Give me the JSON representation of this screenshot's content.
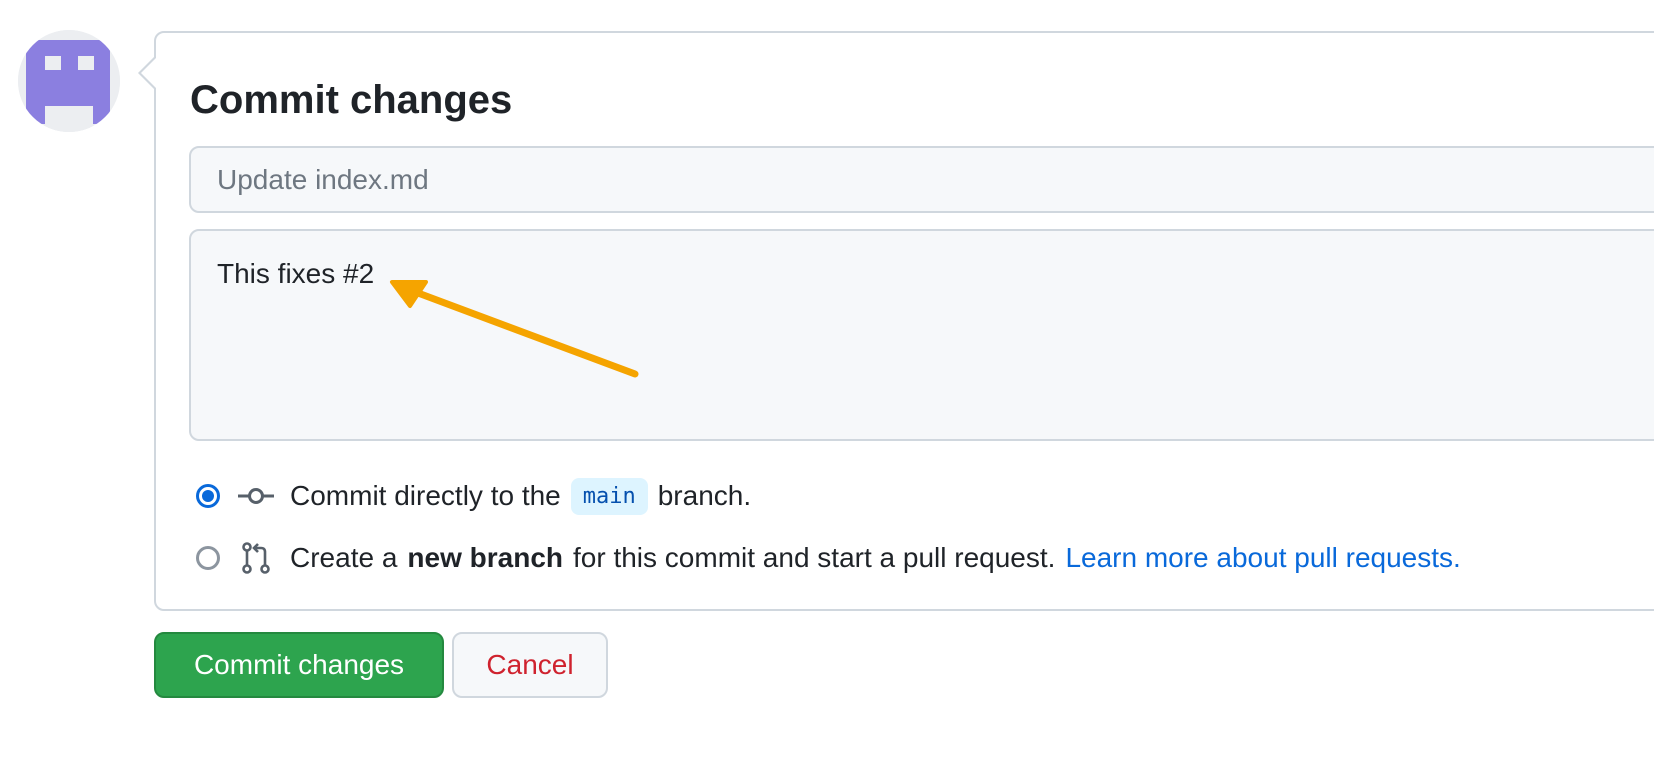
{
  "header": {
    "title": "Commit changes"
  },
  "form": {
    "summary_placeholder": "Update index.md",
    "summary_value": "",
    "description_value": "This fixes #2"
  },
  "options": {
    "direct": {
      "prefix": "Commit directly to the",
      "branch": "main",
      "suffix": "branch.",
      "selected": true
    },
    "new_branch": {
      "prefix": "Create a",
      "bold": "new branch",
      "suffix": "for this commit and start a pull request.",
      "link": "Learn more about pull requests.",
      "selected": false
    }
  },
  "buttons": {
    "commit_label": "Commit changes",
    "cancel_label": "Cancel"
  },
  "icons": {
    "avatar": "identicon-avatar",
    "commit": "git-commit-icon",
    "pull_request": "git-pull-request-icon",
    "annotation": "annotation-arrow"
  },
  "colors": {
    "accent": "#0969da",
    "primary_button": "#2da44e",
    "danger": "#cf222e",
    "annotation_arrow": "#f5a400",
    "avatar": "#8b7fe0"
  }
}
